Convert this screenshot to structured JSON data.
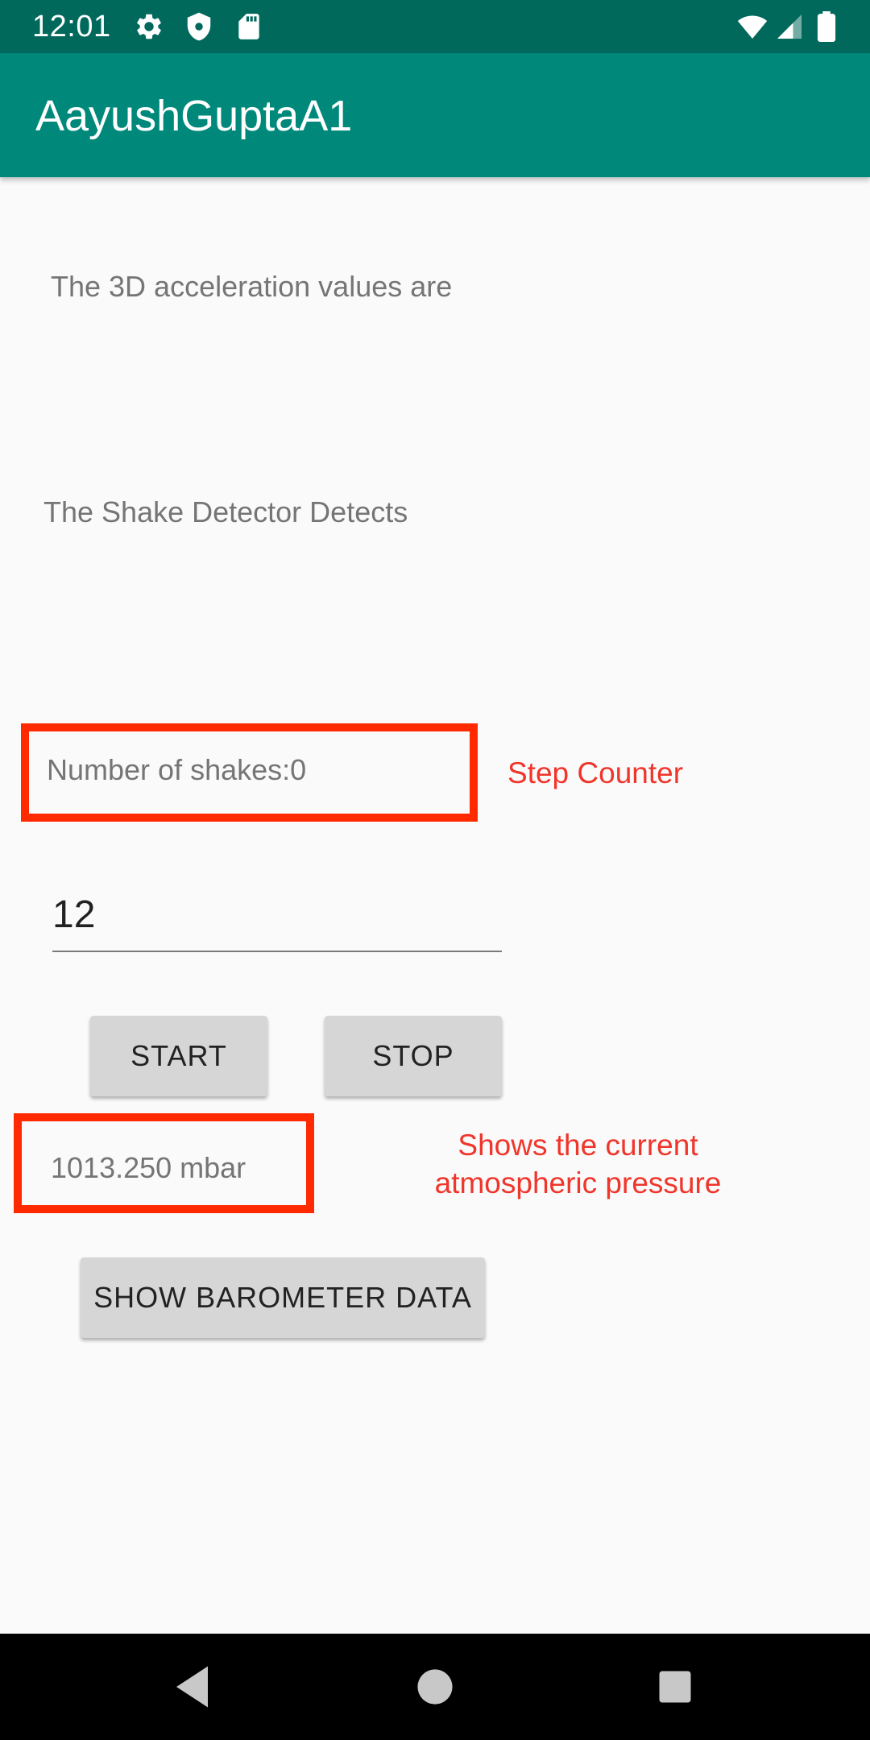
{
  "status_bar": {
    "time": "12:01",
    "icons_left": [
      "gear-icon",
      "shield-icon",
      "sd-card-icon"
    ],
    "icons_right": [
      "wifi-icon",
      "signal-icon",
      "battery-icon"
    ]
  },
  "app_bar": {
    "title": "AayushGuptaA1",
    "color": "#00897b"
  },
  "main": {
    "acceleration_label": "The 3D acceleration values are",
    "shake_detector_label": "The Shake Detector Detects",
    "shake_count_text": "Number of shakes:0",
    "input_value": "12",
    "start_label": "START",
    "stop_label": "STOP",
    "pressure_text": "1013.250 mbar",
    "barometer_button_label": "SHOW BAROMETER DATA"
  },
  "annotations": {
    "step_counter": "Step Counter",
    "pressure_line1": "Shows the current",
    "pressure_line2": "atmospheric pressure",
    "color": "#ff2a00"
  },
  "nav_bar": {
    "buttons": [
      "back-icon",
      "home-icon",
      "recents-icon"
    ]
  }
}
